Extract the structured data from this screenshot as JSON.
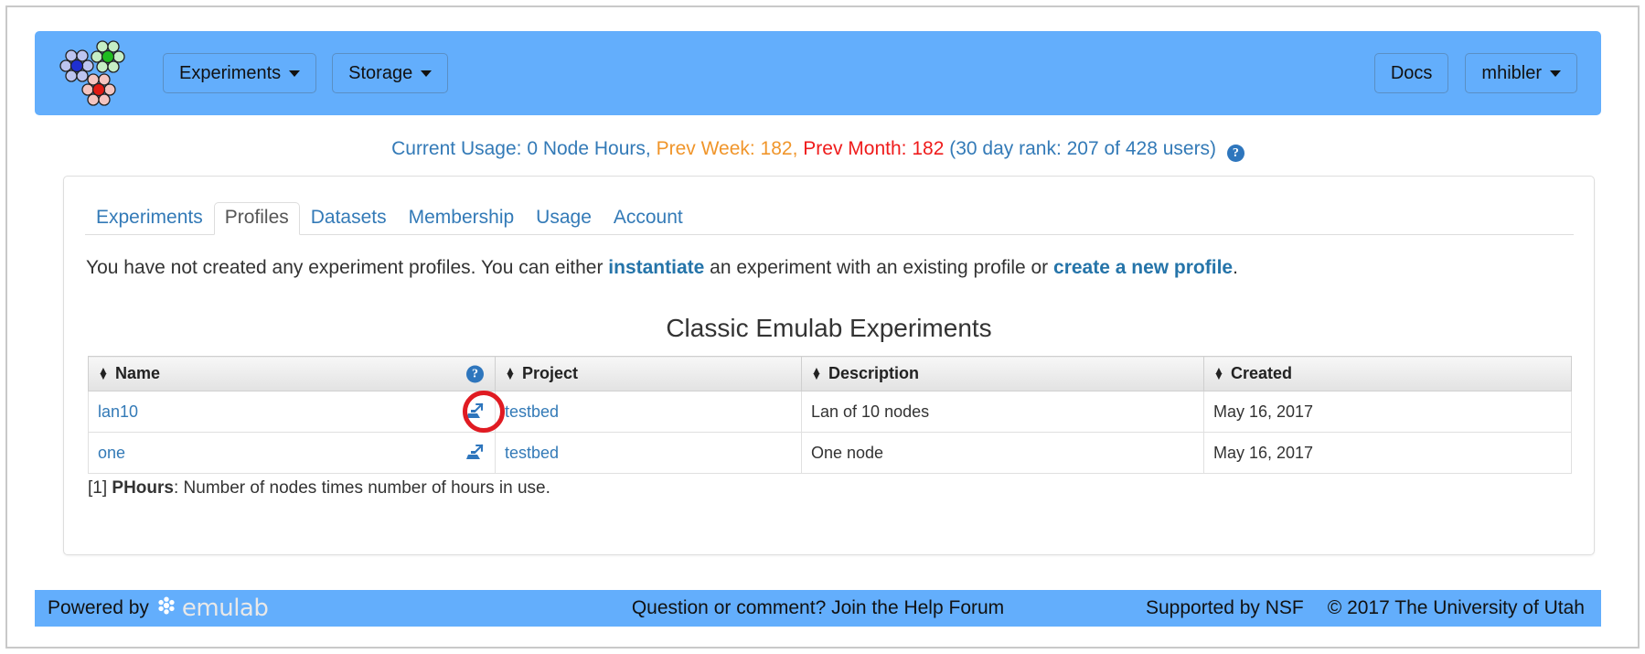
{
  "navbar": {
    "logo_name": "emulab-node-cluster-logo",
    "left_buttons": [
      {
        "label": "Experiments",
        "has_caret": true
      },
      {
        "label": "Storage",
        "has_caret": true
      }
    ],
    "right_buttons": [
      {
        "label": "Docs",
        "has_caret": false
      },
      {
        "label": "mhibler",
        "has_caret": true
      }
    ],
    "background_color": "#63aefc"
  },
  "usage": {
    "current": "Current Usage: 0 Node Hours,",
    "prev_week": "Prev Week: 182,",
    "prev_month": "Prev Month: 182",
    "rank": "(30 day rank: 207 of 428 users)",
    "help_glyph": "?",
    "colors": {
      "normal": "#337ab7",
      "warning": "#f0952a",
      "danger": "#ef1b1b"
    }
  },
  "tabs": [
    {
      "label": "Experiments",
      "active": false
    },
    {
      "label": "Profiles",
      "active": true
    },
    {
      "label": "Datasets",
      "active": false
    },
    {
      "label": "Membership",
      "active": false
    },
    {
      "label": "Usage",
      "active": false
    },
    {
      "label": "Account",
      "active": false
    }
  ],
  "intro": {
    "part1": "You have not created any experiment profiles. You can either ",
    "link1": "instantiate",
    "part2": " an experiment with an existing profile or ",
    "link2": "create a new profile",
    "part3": "."
  },
  "section_title": "Classic Emulab Experiments",
  "table": {
    "columns": [
      {
        "label": "Name",
        "has_help": true
      },
      {
        "label": "Project",
        "has_help": false
      },
      {
        "label": "Description",
        "has_help": false
      },
      {
        "label": "Created",
        "has_help": false
      }
    ],
    "rows": [
      {
        "name": "lan10",
        "project": "testbed",
        "description": "Lan of 10 nodes",
        "created": "May 16, 2017",
        "icon": "export-experiment-icon",
        "annotated": true
      },
      {
        "name": "one",
        "project": "testbed",
        "description": "One node",
        "created": "May 16, 2017",
        "icon": "export-experiment-icon",
        "annotated": false
      }
    ]
  },
  "footnote": {
    "marker": "[1] ",
    "term": "PHours",
    "text": ": Number of nodes times number of hours in use."
  },
  "footer": {
    "powered_by": "Powered by",
    "brand": "emulab",
    "center": "Question or comment? Join the Help Forum",
    "nsf": "Supported by NSF",
    "copyright": "© 2017 The University of Utah"
  },
  "annotation": {
    "color": "#e01b22",
    "shape": "circle"
  }
}
